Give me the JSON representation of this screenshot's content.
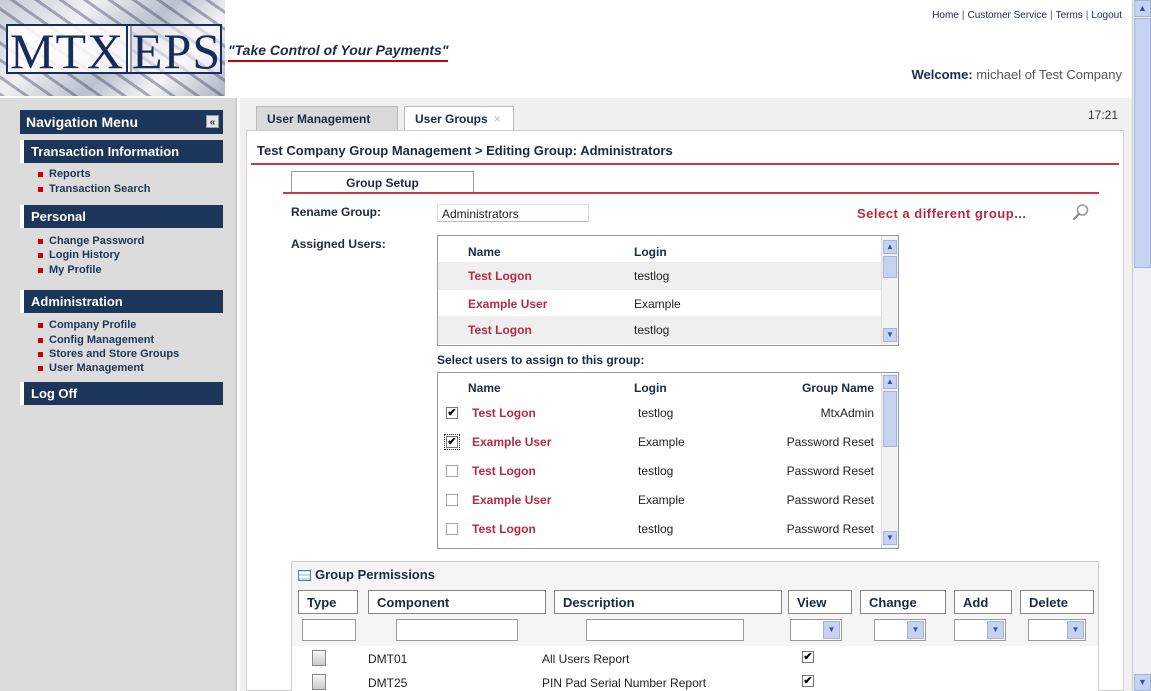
{
  "header": {
    "logo_text_left": "MTX",
    "logo_text_right": "EPS",
    "tagline": "\"Take Control of Your Payments\"",
    "links": [
      "Home",
      "Customer Service",
      "Terms",
      "Logout"
    ],
    "welcome_label": "Welcome:",
    "welcome_user": "michael of Test Company"
  },
  "nav": {
    "title": "Navigation Menu",
    "collapse_glyph": "«",
    "sections": [
      {
        "label": "Transaction Information",
        "items": [
          "Reports",
          "Transaction Search"
        ]
      },
      {
        "label": "Personal",
        "items": [
          "Change Password",
          "Login History",
          "My Profile"
        ]
      },
      {
        "label": "Administration",
        "items": [
          "Company Profile",
          "Config Management",
          "Stores and Store Groups",
          "User Management"
        ]
      },
      {
        "label": "Log Off",
        "items": []
      }
    ]
  },
  "tabs": {
    "user_management": "User Management",
    "user_groups": "User Groups",
    "close_glyph": "×",
    "clock": "17:21"
  },
  "page": {
    "breadcrumb": "Test Company Group Management > Editing Group: Administrators",
    "subtab": "Group Setup",
    "rename_label": "Rename Group:",
    "rename_value": "Administrators",
    "select_group": "Select a different group...",
    "assigned_label": "Assigned Users:",
    "select_users_label": "Select users to assign to this group:"
  },
  "assigned": {
    "headers": {
      "name": "Name",
      "login": "Login"
    },
    "rows": [
      {
        "name": "Test Logon",
        "login": "testlog"
      },
      {
        "name": "Example User",
        "login": "Example"
      },
      {
        "name": "Test Logon",
        "login": "testlog"
      }
    ]
  },
  "selectable": {
    "headers": {
      "name": "Name",
      "login": "Login",
      "group": "Group Name"
    },
    "rows": [
      {
        "checked": true,
        "name": "Test Logon",
        "login": "testlog",
        "group": "MtxAdmin"
      },
      {
        "checked": true,
        "name": "Example User",
        "login": "Example",
        "group": "Password Reset"
      },
      {
        "checked": false,
        "name": "Test Logon",
        "login": "testlog",
        "group": "Password Reset"
      },
      {
        "checked": false,
        "name": "Example User",
        "login": "Example",
        "group": "Password Reset"
      },
      {
        "checked": false,
        "name": "Test Logon",
        "login": "testlog",
        "group": "Password Reset"
      }
    ]
  },
  "permissions": {
    "title": "Group Permissions",
    "columns": {
      "type": "Type",
      "component": "Component",
      "description": "Description",
      "view": "View",
      "change": "Change",
      "add": "Add",
      "delete": "Delete"
    },
    "rows": [
      {
        "component": "DMT01",
        "description": "All Users Report",
        "view": true
      },
      {
        "component": "DMT25",
        "description": "PIN Pad Serial Number Report",
        "view": true
      }
    ]
  },
  "glyphs": {
    "check": "✔",
    "up": "▲",
    "down": "▼"
  }
}
